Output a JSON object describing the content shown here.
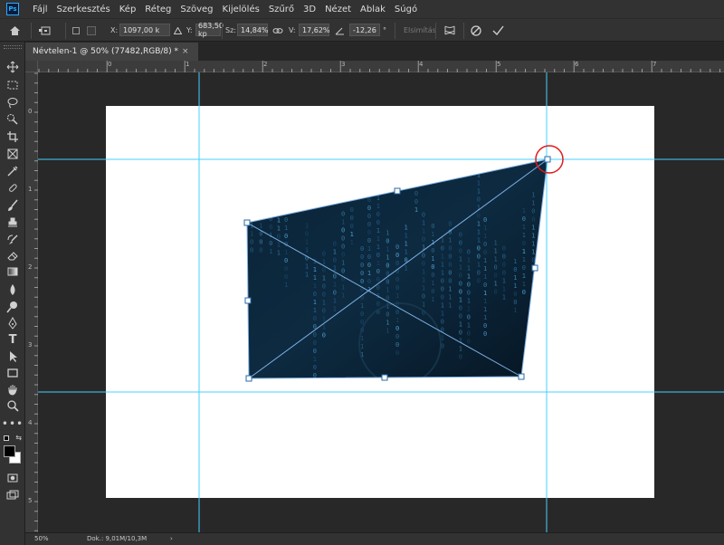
{
  "app": {
    "logo": "Ps"
  },
  "menu": [
    "Fájl",
    "Szerkesztés",
    "Kép",
    "Réteg",
    "Szöveg",
    "Kijelölés",
    "Szűrő",
    "3D",
    "Nézet",
    "Ablak",
    "Súgó"
  ],
  "options": {
    "x_label": "X:",
    "x_value": "1097,00 k",
    "y_label": "Y:",
    "y_value": "683,50 kp",
    "w_label": "Sz:",
    "w_value": "14,84%",
    "h_label": "V:",
    "h_value": "17,62%",
    "angle_value": "-12,26",
    "degree_symbol": "°",
    "interpolation_label": "Elsimítás",
    "icons": [
      "home-icon",
      "reference-point-icon",
      "link-icon",
      "angle-icon",
      "warp-icon",
      "cancel-icon",
      "commit-icon"
    ]
  },
  "document": {
    "tab_title": "Névtelen-1 @ 50% (77482,RGB/8) *",
    "close_glyph": "×"
  },
  "rulers": {
    "top_numbers": [
      "0",
      "1",
      "2",
      "3",
      "4",
      "5",
      "6",
      "7"
    ],
    "left_numbers": [
      "0",
      "1",
      "2",
      "3",
      "4",
      "5"
    ]
  },
  "status": {
    "zoom": "50%",
    "doc_info": "Dok.: 9,01M/10,3M",
    "arrow": "›"
  },
  "colors": {
    "guide": "#45d0ff",
    "highlight_circle": "#e01b1b",
    "transform_line": "#7fb2e6",
    "image_dark": "#0a1e30",
    "image_accent": "#2f7fb3"
  }
}
